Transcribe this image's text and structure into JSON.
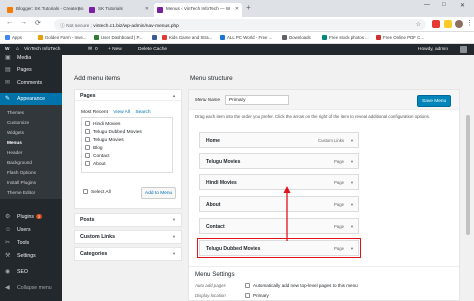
{
  "browser": {
    "tabs": [
      {
        "label": "Blogger: SK Tutorials - Create po"
      },
      {
        "label": "SK Tutorials"
      },
      {
        "label": "Menus ‹ VinTech InfoTech — W"
      }
    ],
    "new_tab": "+",
    "win_min": "—",
    "win_max": "□",
    "win_close": "✕",
    "tab_close": "✕",
    "back": "←",
    "forward": "→",
    "reload": "⟳",
    "security": "ⓘ Not secure",
    "url": "vintech.c1.biz/wp-admin/nav-menus.php",
    "star": "☆",
    "menu_dots": "⋮"
  },
  "bookmarks": [
    {
      "label": "Apps",
      "color": "#4285f4"
    },
    {
      "label": "Golden Farm - Inve...",
      "color": "#e8a000"
    },
    {
      "label": "User Dashboard | P...",
      "color": "#2e7d32"
    },
    {
      "label": "",
      "color": "#3b5998"
    },
    {
      "label": "Kids Game and Stra...",
      "color": "#e53935"
    },
    {
      "label": "ALL PC World - Free ...",
      "color": "#1976d2"
    },
    {
      "label": "Downloads",
      "color": "#5f6368"
    },
    {
      "label": "Free stock photos ...",
      "color": "#00897b"
    },
    {
      "label": "Free Online PDF C...",
      "color": "#d32f2f"
    }
  ],
  "adminbar": {
    "wp_logo": "W",
    "site_name": "VinTech InfoTech",
    "comments_count": "0",
    "new": "+ New",
    "delete_cache": "Delete Cache",
    "howdy": "Howdy, admin"
  },
  "sidebar": {
    "items": [
      {
        "label": "Media",
        "icon": "▣"
      },
      {
        "label": "Pages",
        "icon": "▤"
      },
      {
        "label": "Comments",
        "icon": "✉"
      },
      {
        "label": "Appearance",
        "icon": "✎"
      }
    ],
    "appearance_sub": [
      "Themes",
      "Customize",
      "Widgets",
      "Menus",
      "Header",
      "Background",
      "Flash Options",
      "Install Plugins",
      "Theme Editor"
    ],
    "lower": [
      {
        "label": "Plugins",
        "icon": "⚙",
        "badge": "2"
      },
      {
        "label": "Users",
        "icon": "☺"
      },
      {
        "label": "Tools",
        "icon": "✂"
      },
      {
        "label": "Settings",
        "icon": "⚒"
      },
      {
        "label": "SEO",
        "icon": "◉"
      },
      {
        "label": "Collapse menu",
        "icon": "◀"
      }
    ]
  },
  "add_menu_items": {
    "title": "Add menu items",
    "pages_header": "Pages",
    "tabs": [
      "Most Recent",
      "View All",
      "Search"
    ],
    "pages": [
      "Hindi Movies",
      "Telugu Dubbed Movies",
      "Telugu Movies",
      "Blog",
      "Contact",
      "About"
    ],
    "select_all": "Select All",
    "add_button": "Add to Menu",
    "posts": "Posts",
    "custom_links": "Custom Links",
    "categories": "Categories"
  },
  "menu_structure": {
    "title": "Menu structure",
    "menu_name_label": "Menu Name",
    "menu_name_value": "Primary",
    "save_button": "Save Menu",
    "instructions": "Drag each item into the order you prefer. Click the arrow on the right of the item to reveal additional configuration options.",
    "items": [
      {
        "label": "Home",
        "type": "Custom Links"
      },
      {
        "label": "Telugu Movies",
        "type": "Page"
      },
      {
        "label": "Hindi Movies",
        "type": "Page"
      },
      {
        "label": "About",
        "type": "Page"
      },
      {
        "label": "Contact",
        "type": "Page"
      },
      {
        "label": "Telugu Dubbed Movies",
        "type": "Page"
      }
    ],
    "settings_title": "Menu Settings",
    "auto_add_label": "Auto add pages",
    "auto_add_text": "Automatically add new top-level pages to this menu",
    "display_location_label": "Display location",
    "display_location_text": "Primary"
  },
  "colors": {
    "accent": "#0073aa",
    "highlight": "#e0121a"
  }
}
